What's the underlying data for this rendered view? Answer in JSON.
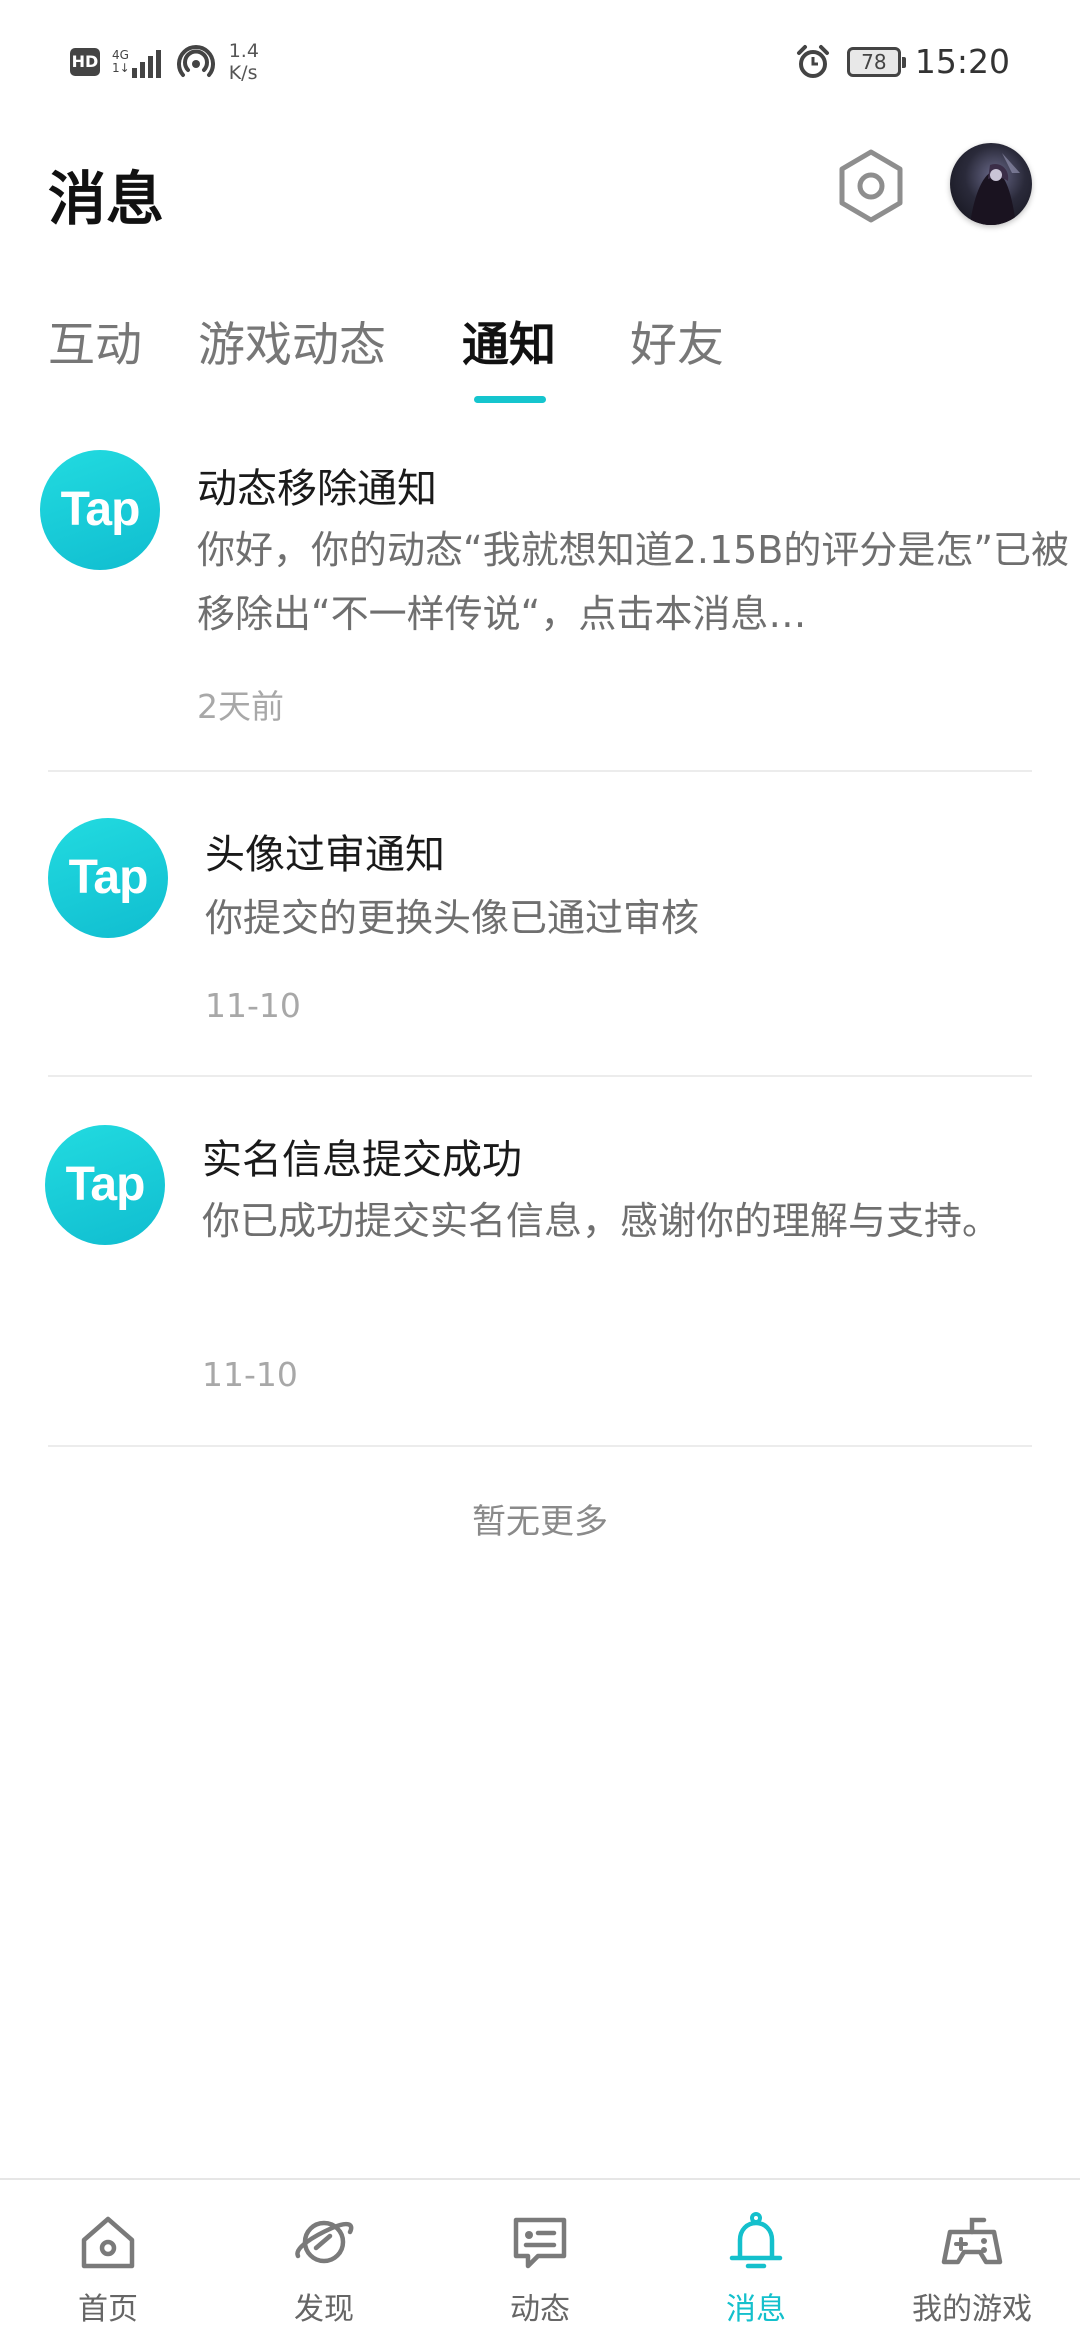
{
  "status_bar": {
    "hd": "HD",
    "net_top": "4G",
    "net_bottom": "1↓",
    "speed_value": "1.4",
    "speed_unit": "K/s",
    "battery": "78",
    "time": "15:20"
  },
  "header": {
    "title": "消息",
    "settings_icon": "gear-hexagon-icon",
    "avatar": "user-avatar"
  },
  "tabs": [
    {
      "label": "互动",
      "active": false
    },
    {
      "label": "游戏动态",
      "active": false
    },
    {
      "label": "通知",
      "active": true
    },
    {
      "label": "好友",
      "active": false
    }
  ],
  "notices": [
    {
      "logo": "Tap",
      "title": "动态移除通知",
      "body": "你好，你的动态“我就想知道2.15B的评分是怎”已被移除出“不一样传说“，点击本消息…",
      "time": "2天前"
    },
    {
      "logo": "Tap",
      "title": "头像过审通知",
      "body": "你提交的更换头像已通过审核",
      "time": "11-10"
    },
    {
      "logo": "Tap",
      "title": "实名信息提交成功",
      "body": "你已成功提交实名信息，感谢你的理解与支持。",
      "time": "11-10"
    }
  ],
  "footer_text": "暂无更多",
  "bottom_nav": [
    {
      "label": "首页",
      "icon": "home-icon",
      "active": false
    },
    {
      "label": "发现",
      "icon": "planet-icon",
      "active": false
    },
    {
      "label": "动态",
      "icon": "message-card-icon",
      "active": false
    },
    {
      "label": "消息",
      "icon": "bell-icon",
      "active": true
    },
    {
      "label": "我的游戏",
      "icon": "gamepad-icon",
      "active": false
    }
  ],
  "colors": {
    "accent": "#15c5ce",
    "tap_logo": "#10bdd0",
    "text_primary": "#111111",
    "text_secondary": "#6f6f6f"
  }
}
